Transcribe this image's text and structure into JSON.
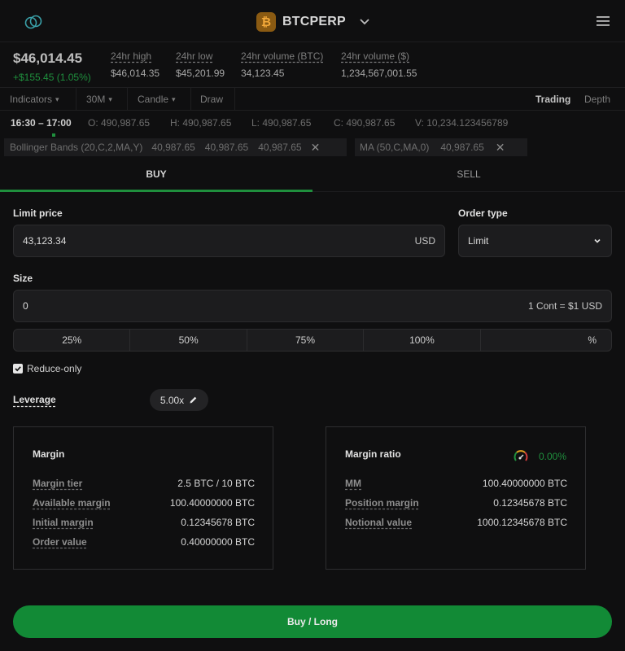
{
  "header": {
    "symbol": "BTCPERP",
    "coin_glyph": "₿",
    "accent": "#1f8f3d"
  },
  "stats": {
    "price": "$46,014.45",
    "change": "+$155.45 (1.05%)",
    "items": [
      {
        "label": "24hr high",
        "value": "$46,014.35"
      },
      {
        "label": "24hr low",
        "value": "$45,201.99"
      },
      {
        "label": "24hr volume (BTC)",
        "value": "34,123.45"
      },
      {
        "label": "24hr volume ($)",
        "value": "1,234,567,001.55"
      }
    ]
  },
  "toolbar": {
    "indicators": "Indicators",
    "interval": "30M",
    "chart_type": "Candle",
    "draw": "Draw",
    "trading": "Trading",
    "depth": "Depth"
  },
  "ohlc": {
    "time": "16:30 – 17:00",
    "open": "O: 490,987.65",
    "high": "H: 490,987.65",
    "low": "L: 490,987.65",
    "close": "C: 490,987.65",
    "volume": "V: 10,234.123456789"
  },
  "indicators": [
    {
      "name": "Bollinger Bands (20,C,2,MA,Y)",
      "values": [
        "40,987.65",
        "40,987.65",
        "40,987.65"
      ]
    },
    {
      "name": "MA (50,C,MA,0)",
      "values": [
        "40,987.65"
      ]
    }
  ],
  "tabs": {
    "buy": "BUY",
    "sell": "SELL"
  },
  "form": {
    "limit_price_label": "Limit price",
    "limit_price_value": "43,123.34",
    "limit_price_suffix": "USD",
    "order_type_label": "Order type",
    "order_type_value": "Limit",
    "size_label": "Size",
    "size_value": "0",
    "size_suffix": "1 Cont = $1 USD",
    "percents": [
      "25%",
      "50%",
      "75%",
      "100%",
      "%"
    ],
    "reduce_only": "Reduce-only",
    "leverage_label": "Leverage",
    "leverage_value": "5.00x"
  },
  "margin": {
    "title": "Margin",
    "rows": [
      {
        "k": "Margin tier",
        "v": "2.5 BTC / 10 BTC"
      },
      {
        "k": "Available margin",
        "v": "100.40000000 BTC"
      },
      {
        "k": "Initial margin",
        "v": "0.12345678 BTC"
      },
      {
        "k": "Order value",
        "v": "0.40000000 BTC"
      }
    ]
  },
  "margin_ratio": {
    "title": "Margin ratio",
    "value": "0.00%",
    "rows": [
      {
        "k": "MM",
        "v": "100.40000000 BTC"
      },
      {
        "k": "Position margin",
        "v": "0.12345678 BTC"
      },
      {
        "k": "Notional value",
        "v": "1000.12345678 BTC"
      }
    ]
  },
  "submit": {
    "label": "Buy / Long"
  }
}
